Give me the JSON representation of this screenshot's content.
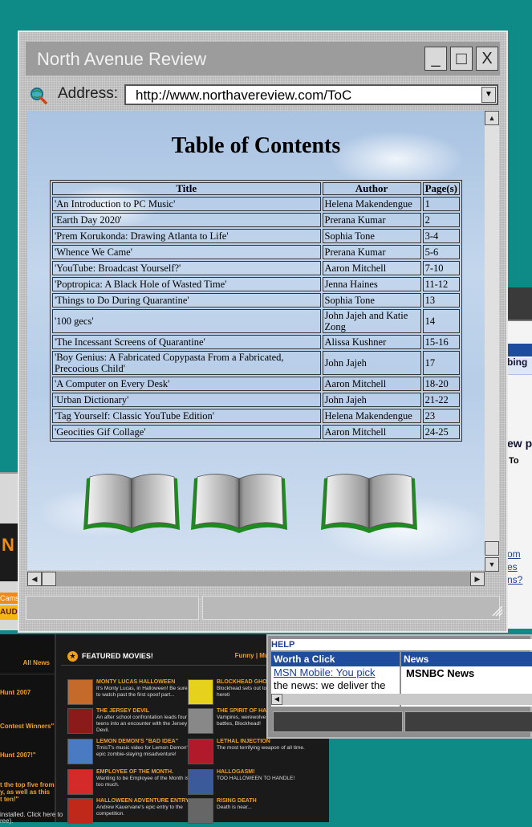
{
  "window": {
    "title": "North Avenue Review",
    "buttons": {
      "minimize": "_",
      "maximize": "□",
      "close": "X"
    },
    "address_label": "Address:",
    "address_url": "http://www.northavereview.com/ToC"
  },
  "page": {
    "heading": "Table of Contents",
    "columns": {
      "title": "Title",
      "author": "Author",
      "pages": "Page(s)"
    },
    "rows": [
      {
        "title": "'An Introduction to PC Music'",
        "author": "Helena Makendengue",
        "pages": "1"
      },
      {
        "title": "'Earth Day 2020'",
        "author": "Prerana Kumar",
        "pages": "2"
      },
      {
        "title": "'Prem Korukonda: Drawing Atlanta to Life'",
        "author": "Sophia Tone",
        "pages": "3-4"
      },
      {
        "title": "'Whence We Came'",
        "author": "Prerana Kumar",
        "pages": "5-6"
      },
      {
        "title": "'YouTube: Broadcast Yourself?'",
        "author": "Aaron Mitchell",
        "pages": "7-10"
      },
      {
        "title": "'Poptropica: A Black Hole of Wasted Time'",
        "author": "Jenna Haines",
        "pages": "11-12"
      },
      {
        "title": "'Things to Do During Quarantine'",
        "author": "Sophia Tone",
        "pages": "13"
      },
      {
        "title": "'100 gecs'",
        "author": "John Jajeh and Katie Zong",
        "pages": "14"
      },
      {
        "title": "'The Incessant Screens of Quarantine'",
        "author": "Alissa Kushner",
        "pages": "15-16"
      },
      {
        "title": "'Boy Genius: A Fabricated Copypasta From a Fabricated, Precocious Child'",
        "author": "John Jajeh",
        "pages": "17"
      },
      {
        "title": "'A Computer on Every Desk'",
        "author": "Aaron Mitchell",
        "pages": "18-20"
      },
      {
        "title": "'Urban Dictionary'",
        "author": "John Jajeh",
        "pages": "21-22"
      },
      {
        "title": "'Tag Yourself: Classic YouTube Edition'",
        "author": "Helena Makendengue",
        "pages": "23"
      },
      {
        "title": "'Geocities Gif Collage'",
        "author": "Aaron Mitchell",
        "pages": "24-25"
      }
    ],
    "books": [
      "book-icon",
      "book-icon",
      "book-icon"
    ]
  },
  "background": {
    "right_window": {
      "heading_fragment": "bing",
      "subheading_fragment": "ew p",
      "label_fragment": "To",
      "link_fragments": [
        "om",
        "es",
        "ns?"
      ]
    },
    "left_window": {
      "logo_fragment": "N",
      "cams": "Cams",
      "audio": "AUD"
    },
    "dark_site": {
      "all_news": "All News",
      "side_items": [
        "Hunt 2007",
        "Contest Winners\"",
        "Hunt 2007!\"",
        "t the top five from",
        "y, as well as this",
        "t ten!\"",
        "installed. Click here to",
        "ree)."
      ],
      "featured_title": "FEATURED MOVIES!",
      "featured_nav": "Funny | Music | Parodies | Dr",
      "movies": [
        {
          "title": "MONTY LUCAS HALLOWEEN",
          "desc": "It's Monty Lucas, in Halloween! Be sure to watch past the first spoof part..."
        },
        {
          "title": "BLOCKHEAD GHOS",
          "desc": "Blockhead sets out to Die, Ghostmas hereti"
        },
        {
          "title": "THE JERSEY DEVIL",
          "desc": "An after school confrontation leads four teens into an encounter with the Jersey Devil."
        },
        {
          "title": "THE SPIRIT OF HAL",
          "desc": "Vampires, werewolve caves, traps, battles, Blockhead!"
        },
        {
          "title": "LEMON DEMON'S \"BAD IDEA\"",
          "desc": "TmisT's music video for Lemon Demon's epic zombie-slaying misadventure!"
        },
        {
          "title": "LETHAL INJECTION",
          "desc": "The most terrifying weapon of all time."
        },
        {
          "title": "EMPLOYEE OF THE MONTH.",
          "desc": "Wanting to be Employee of the Month is too much."
        },
        {
          "title": "HALLOGASM!",
          "desc": "TOO HALLOWEEN TO HANDLE!"
        },
        {
          "title": "HALLOWEEN ADVENTURE ENTRY",
          "desc": "Andrew Kauervane's epic entry to the competition."
        },
        {
          "title": "RISING DEATH",
          "desc": "Death is near..."
        }
      ]
    },
    "msn_window": {
      "help": "HELP",
      "panel1_title": "Worth a Click",
      "panel1_link": "MSN Mobile: You pick",
      "panel1_text": "the news: we deliver the",
      "panel2_title": "News",
      "panel2_text": "MSNBC News"
    }
  }
}
